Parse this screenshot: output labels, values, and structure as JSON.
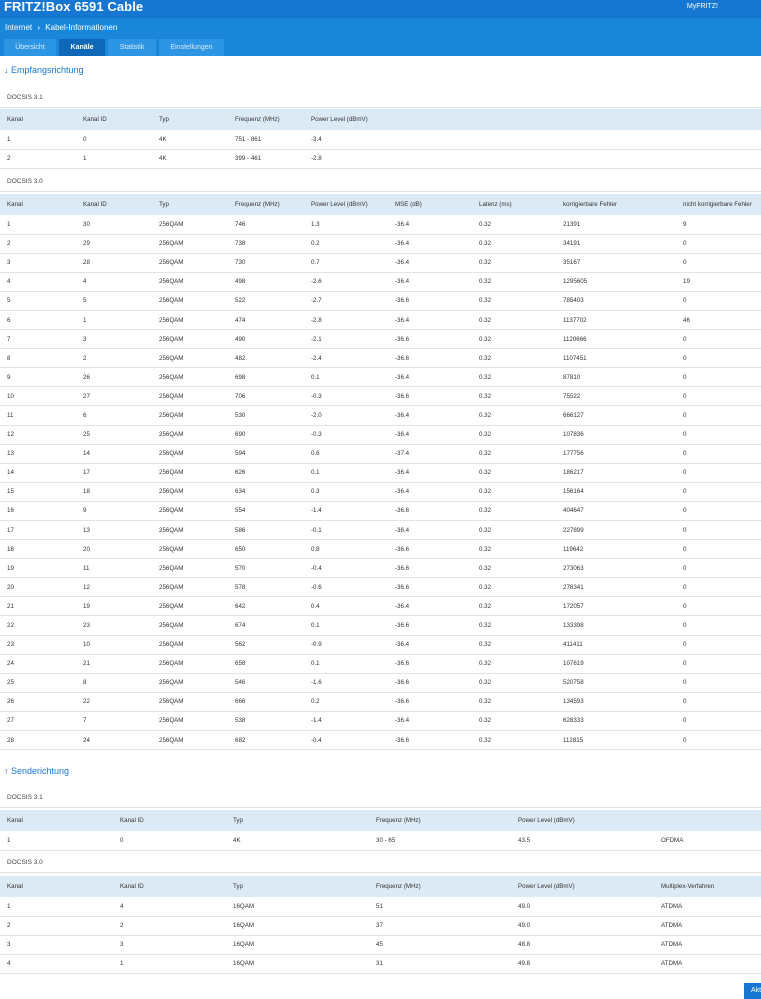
{
  "header": {
    "title": "FRITZ!Box 6591 Cable",
    "myfritz": "MyFRITZ!"
  },
  "breadcrumb": {
    "parent": "Internet",
    "current": "Kabel-Informationen",
    "separator": "›"
  },
  "tabs": [
    "Übersicht",
    "Kanäle",
    "Statistik",
    "Einstellungen"
  ],
  "down": {
    "title": "↓ Empfangsrichtung",
    "d31": {
      "label": "DOCSIS 3.1",
      "headers": [
        "Kanal",
        "Kanal ID",
        "Typ",
        "Frequenz (MHz)",
        "Power Level (dBmV)"
      ],
      "rows": [
        [
          "1",
          "0",
          "4K",
          "751 - 861",
          "-3.4"
        ],
        [
          "2",
          "1",
          "4K",
          "399 - 461",
          "-2.8"
        ]
      ]
    },
    "d30": {
      "label": "DOCSIS 3.0",
      "headers": [
        "Kanal",
        "Kanal ID",
        "Typ",
        "Frequenz (MHz)",
        "Power Level (dBmV)",
        "MSE (dB)",
        "Latenz (ms)",
        "korrigierbare Fehler",
        "nicht korrigierbare Fehler"
      ],
      "rows": [
        [
          "1",
          "30",
          "256QAM",
          "746",
          "1.3",
          "-36.4",
          "0.32",
          "21391",
          "9"
        ],
        [
          "2",
          "29",
          "256QAM",
          "738",
          "0.2",
          "-36.4",
          "0.32",
          "34191",
          "0"
        ],
        [
          "3",
          "28",
          "256QAM",
          "730",
          "0.7",
          "-36.4",
          "0.32",
          "35167",
          "0"
        ],
        [
          "4",
          "4",
          "256QAM",
          "498",
          "-2.6",
          "-36.4",
          "0.32",
          "1295605",
          "19"
        ],
        [
          "5",
          "5",
          "256QAM",
          "522",
          "-2.7",
          "-36.6",
          "0.32",
          "785403",
          "0"
        ],
        [
          "6",
          "1",
          "256QAM",
          "474",
          "-2.8",
          "-36.4",
          "0.32",
          "1137702",
          "46"
        ],
        [
          "7",
          "3",
          "256QAM",
          "490",
          "-2.1",
          "-36.6",
          "0.32",
          "1120666",
          "0"
        ],
        [
          "8",
          "2",
          "256QAM",
          "482",
          "-2.4",
          "-36.6",
          "0.32",
          "1107451",
          "0"
        ],
        [
          "9",
          "26",
          "256QAM",
          "698",
          "0.1",
          "-36.4",
          "0.32",
          "87810",
          "0"
        ],
        [
          "10",
          "27",
          "256QAM",
          "706",
          "-0.3",
          "-36.6",
          "0.32",
          "75522",
          "0"
        ],
        [
          "11",
          "6",
          "256QAM",
          "530",
          "-2.0",
          "-36.4",
          "0.32",
          "666127",
          "0"
        ],
        [
          "12",
          "25",
          "256QAM",
          "690",
          "-0.3",
          "-36.4",
          "0.32",
          "107836",
          "0"
        ],
        [
          "13",
          "14",
          "256QAM",
          "594",
          "0.6",
          "-37.4",
          "0.32",
          "177756",
          "0"
        ],
        [
          "14",
          "17",
          "256QAM",
          "626",
          "0.1",
          "-36.4",
          "0.32",
          "186217",
          "0"
        ],
        [
          "15",
          "18",
          "256QAM",
          "634",
          "0.3",
          "-36.4",
          "0.32",
          "156164",
          "0"
        ],
        [
          "16",
          "9",
          "256QAM",
          "554",
          "-1.4",
          "-36.6",
          "0.32",
          "404647",
          "0"
        ],
        [
          "17",
          "13",
          "256QAM",
          "586",
          "-0.1",
          "-36.4",
          "0.32",
          "227899",
          "0"
        ],
        [
          "18",
          "20",
          "256QAM",
          "650",
          "0.8",
          "-36.6",
          "0.32",
          "119642",
          "0"
        ],
        [
          "19",
          "11",
          "256QAM",
          "570",
          "-0.4",
          "-36.6",
          "0.32",
          "273063",
          "0"
        ],
        [
          "20",
          "12",
          "256QAM",
          "578",
          "-0.6",
          "-36.6",
          "0.32",
          "278341",
          "0"
        ],
        [
          "21",
          "19",
          "256QAM",
          "642",
          "0.4",
          "-36.4",
          "0.32",
          "172057",
          "0"
        ],
        [
          "22",
          "23",
          "256QAM",
          "674",
          "0.1",
          "-36.6",
          "0.32",
          "133398",
          "0"
        ],
        [
          "23",
          "10",
          "256QAM",
          "562",
          "-0.9",
          "-36.4",
          "0.32",
          "411411",
          "0"
        ],
        [
          "24",
          "21",
          "256QAM",
          "658",
          "0.1",
          "-36.6",
          "0.32",
          "107619",
          "0"
        ],
        [
          "25",
          "8",
          "256QAM",
          "546",
          "-1.6",
          "-36.6",
          "0.32",
          "520758",
          "0"
        ],
        [
          "26",
          "22",
          "256QAM",
          "666",
          "0.2",
          "-36.6",
          "0.32",
          "134593",
          "0"
        ],
        [
          "27",
          "7",
          "256QAM",
          "538",
          "-1.4",
          "-36.4",
          "0.32",
          "628333",
          "0"
        ],
        [
          "28",
          "24",
          "256QAM",
          "682",
          "-0.4",
          "-36.6",
          "0.32",
          "112815",
          "0"
        ]
      ]
    }
  },
  "up": {
    "title": "↑ Senderichtung",
    "d31": {
      "label": "DOCSIS 3.1",
      "headers": [
        "Kanal",
        "Kanal ID",
        "Typ",
        "Frequenz (MHz)",
        "Power Level (dBmV)",
        ""
      ],
      "rows": [
        [
          "1",
          "0",
          "4K",
          "30 - 65",
          "43.5",
          "OFDMA"
        ]
      ]
    },
    "d30": {
      "label": "DOCSIS 3.0",
      "headers": [
        "Kanal",
        "Kanal ID",
        "Typ",
        "Frequenz (MHz)",
        "Power Level (dBmV)",
        "Multiplex-Verfahren"
      ],
      "rows": [
        [
          "1",
          "4",
          "16QAM",
          "51",
          "49.0",
          "ATDMA"
        ],
        [
          "2",
          "2",
          "16QAM",
          "37",
          "49.0",
          "ATDMA"
        ],
        [
          "3",
          "3",
          "16QAM",
          "45",
          "48.8",
          "ATDMA"
        ],
        [
          "4",
          "1",
          "16QAM",
          "31",
          "49.8",
          "ATDMA"
        ]
      ]
    }
  },
  "apply_label": "Akt"
}
